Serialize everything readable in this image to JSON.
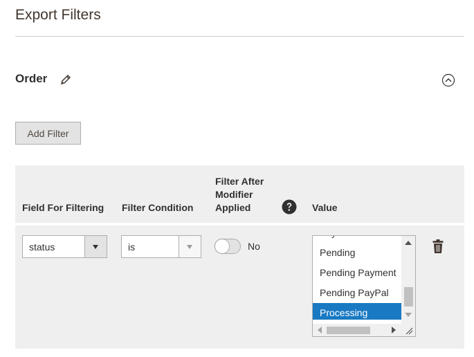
{
  "header": {
    "title": "Export Filters"
  },
  "section": {
    "title": "Order"
  },
  "toolbar": {
    "add_filter_label": "Add Filter"
  },
  "table": {
    "columns": {
      "field": "Field For Filtering",
      "condition": "Filter Condition",
      "modifier_line1": "Filter After",
      "modifier_line2": "Modifier",
      "modifier_line3": "Applied",
      "value": "Value"
    },
    "row": {
      "field_value": "status",
      "condition_value": "is",
      "modifier_toggle": {
        "state": "off",
        "label": "No"
      },
      "value_options": [
        "Payment Review",
        "Pending",
        "Pending Payment",
        "Pending PayPal",
        "Processing"
      ],
      "value_selected": "Processing"
    }
  },
  "icons": {
    "edit": "pencil-icon",
    "collapse": "collapse-circle-up-icon",
    "help": "question-mark-icon",
    "delete": "trash-icon"
  },
  "colors": {
    "selected_bg": "#1979c3",
    "panel_bg": "#efefef",
    "button_bg": "#e3e3e3"
  }
}
